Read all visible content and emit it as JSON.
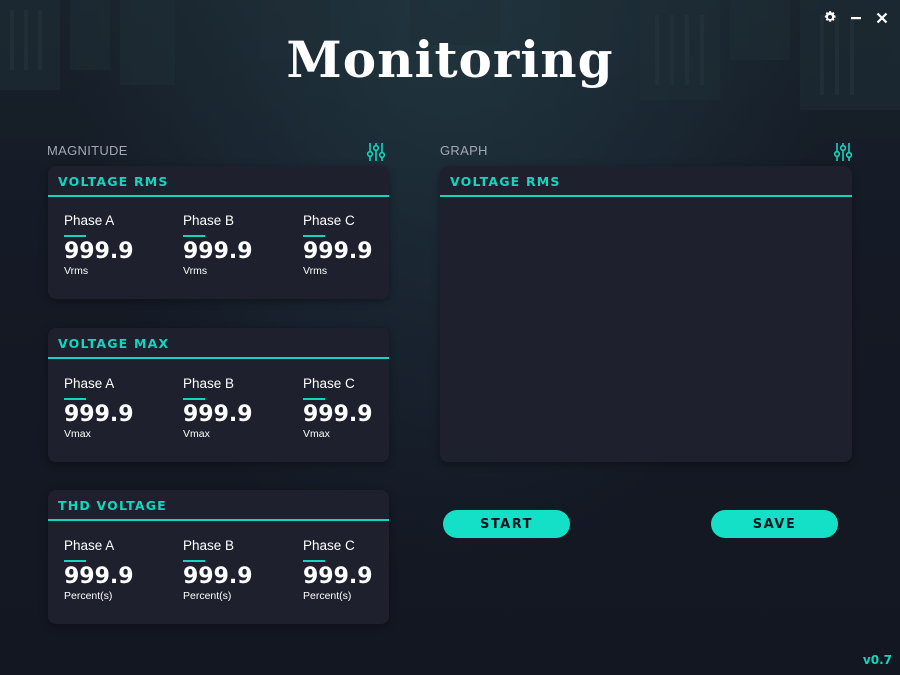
{
  "app": {
    "title": "Monitoring",
    "version": "v0.7",
    "accent_color": "#13d6c0",
    "background_color": "#141925",
    "card_color": "#1e212d"
  },
  "window_controls": {
    "settings_icon": "gear-icon",
    "minimize_icon": "minimize-icon",
    "close_icon": "close-icon"
  },
  "magnitude": {
    "label": "MAGNITUDE",
    "settings_icon": "sliders-icon",
    "cards": [
      {
        "title": "VOLTAGE RMS",
        "phases": [
          {
            "name": "Phase A",
            "value": "999.9",
            "unit": "Vrms"
          },
          {
            "name": "Phase B",
            "value": "999.9",
            "unit": "Vrms"
          },
          {
            "name": "Phase C",
            "value": "999.9",
            "unit": "Vrms"
          }
        ]
      },
      {
        "title": "VOLTAGE MAX",
        "phases": [
          {
            "name": "Phase A",
            "value": "999.9",
            "unit": "Vmax"
          },
          {
            "name": "Phase B",
            "value": "999.9",
            "unit": "Vmax"
          },
          {
            "name": "Phase C",
            "value": "999.9",
            "unit": "Vmax"
          }
        ]
      },
      {
        "title": "THD VOLTAGE",
        "phases": [
          {
            "name": "Phase A",
            "value": "999.9",
            "unit": "Percent(s)"
          },
          {
            "name": "Phase B",
            "value": "999.9",
            "unit": "Percent(s)"
          },
          {
            "name": "Phase C",
            "value": "999.9",
            "unit": "Percent(s)"
          }
        ]
      }
    ]
  },
  "graph": {
    "label": "GRAPH",
    "settings_icon": "sliders-icon",
    "title": "VOLTAGE RMS"
  },
  "actions": {
    "start_label": "START",
    "save_label": "SAVE"
  }
}
